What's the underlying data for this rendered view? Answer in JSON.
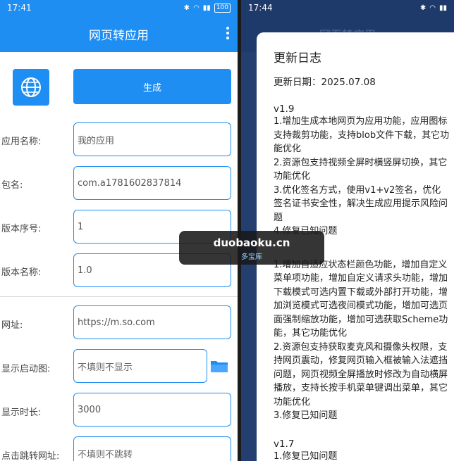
{
  "left": {
    "status_time": "17:41",
    "battery": "100",
    "app_title": "网页转应用",
    "generate_label": "生成",
    "fields": [
      {
        "label": "应用名称:",
        "value": "我的应用"
      },
      {
        "label": "包名:",
        "value": "com.a1781602837814"
      },
      {
        "label": "版本序号:",
        "value": "1"
      },
      {
        "label": "版本名称:",
        "value": "1.0"
      },
      {
        "label": "网址:",
        "value": "https://m.so.com"
      },
      {
        "label": "显示启动图:",
        "value": "不填则不显示"
      },
      {
        "label": "显示时长:",
        "value": "3000"
      },
      {
        "label": "点击跳转网址:",
        "value": "不填则不跳转"
      }
    ]
  },
  "right": {
    "status_time": "17:44",
    "background_title": "网页转应用",
    "dialog": {
      "title": "更新日志",
      "date": "更新日期：2025.07.08",
      "v19": "v1.9",
      "v19_text": "1.增加生成本地网页为应用功能，应用图标支持裁剪功能，支持blob文件下载，其它功能优化\n2.资源包支持视频全屏时横竖屏切换，其它功能优化\n3.优化签名方式，使用v1+v2签名，优化签名证书安全性，解决生成应用提示风险问题\n4.修复已知问题",
      "v18_text": "1.增加自适应状态栏颜色功能，增加自定义菜单项功能，增加自定义请求头功能，增加下载模式可选内置下载或外部打开功能，增加浏览模式可选夜间模式功能，增加可选页面强制缩放功能，增加可选获取Scheme功能，其它功能优化\n2.资源包支持获取麦克风和摄像头权限，支持网页震动，修复网页输入框被输入法遮挡问题，网页视频全屏播放时修改为自动横屏播放，支持长按手机菜单键调出菜单，其它功能优化\n3.修复已知问题",
      "v17": "v1.7",
      "v17_text": "1.修复已知问题"
    }
  },
  "watermark": {
    "main": "duobaoku.cn",
    "sub": "多宝库"
  }
}
